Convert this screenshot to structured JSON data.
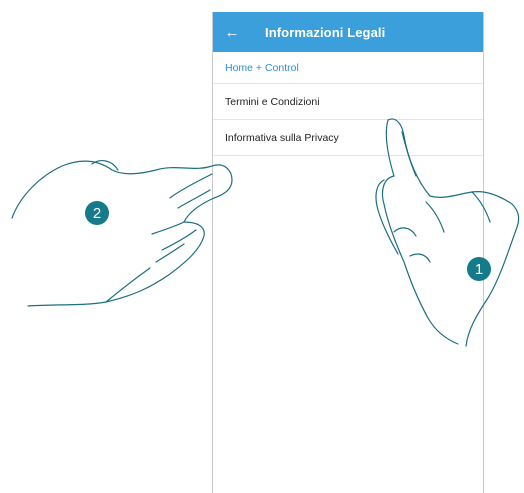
{
  "appbar": {
    "back_icon": "arrow-left-icon",
    "title": "Informazioni Legali"
  },
  "list": {
    "section_header": "Home + Control",
    "items": [
      {
        "label": "Termini e Condizioni"
      },
      {
        "label": "Informativa sulla Privacy"
      }
    ]
  },
  "annotations": {
    "badge_1": "1",
    "badge_2": "2"
  },
  "colors": {
    "appbar": "#3a9fda",
    "section_text": "#2f8ed2",
    "badge": "#157a8a"
  }
}
